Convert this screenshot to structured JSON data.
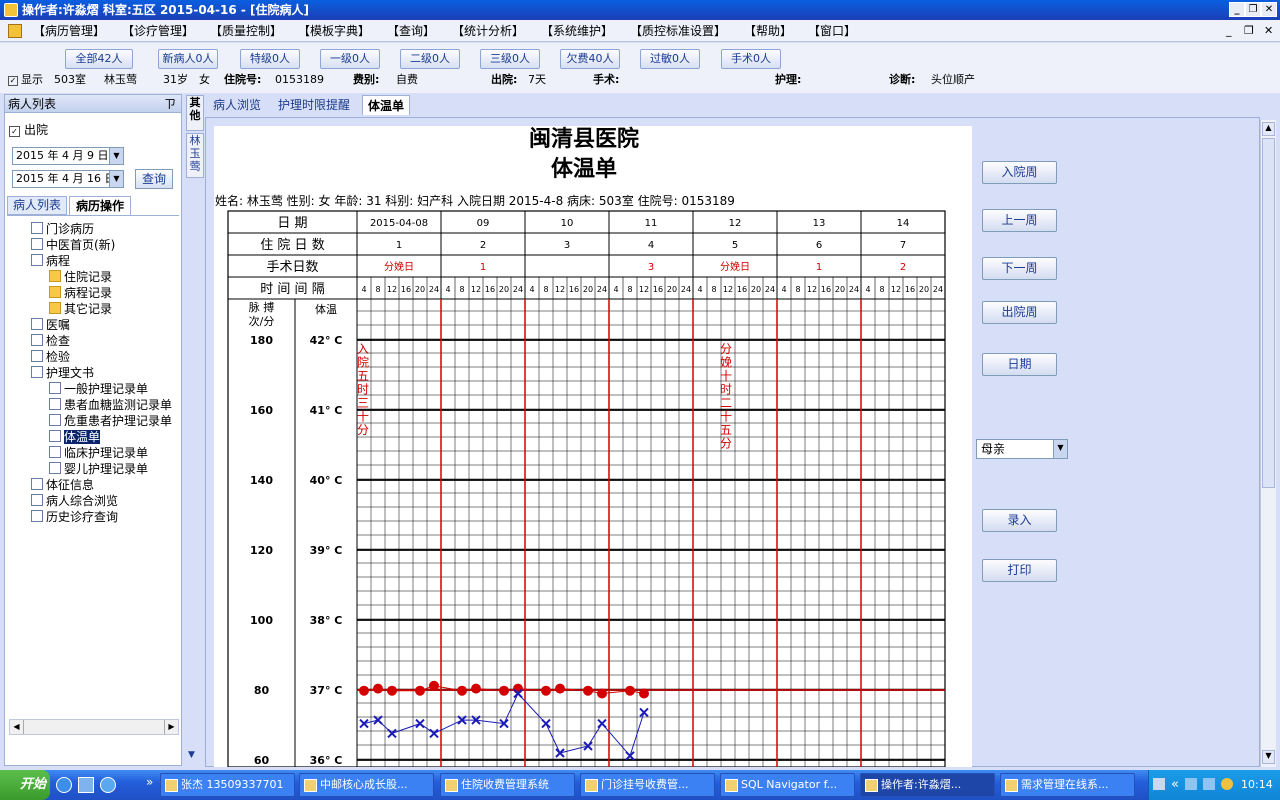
{
  "window": {
    "title": "操作者:许淼熠   科室:五区   2015-04-16 - [住院病人]"
  },
  "menu": [
    "【病历管理】",
    "【诊疗管理】",
    "【质量控制】",
    "【模板字典】",
    "【查询】",
    "【统计分析】",
    "【系统维护】",
    "【质控标准设置】",
    "【帮助】",
    "【窗口】"
  ],
  "filters": [
    "全部42人",
    "新病人0人",
    "特级0人",
    "一级0人",
    "二级0人",
    "三级0人",
    "欠费40人",
    "过敏0人",
    "手术0人"
  ],
  "patient_info": {
    "show": "显示",
    "room": "503室",
    "name": "林玉莺",
    "age": "31岁",
    "sex": "女",
    "inpatient_label": "住院号:",
    "inpatient_no": "0153189",
    "fee_label": "费别:",
    "fee": "自费",
    "discharge_label": "出院:",
    "discharge": "7天",
    "surgery_label": "手术:",
    "nursing_label": "护理:",
    "diagnosis_label": "诊断:",
    "diagnosis": "头位顺产"
  },
  "left_panel": {
    "title": "病人列表",
    "pin": "ㄗ",
    "discharge_check": "出院",
    "date_from": "2015 年 4 月 9 日",
    "date_to": "2015 年 4 月 16 日",
    "query": "查询",
    "tabs": [
      "病人列表",
      "病历操作"
    ],
    "tree": [
      "门诊病历",
      "中医首页(新)",
      "病程",
      "住院记录",
      "病程记录",
      "其它记录",
      "医嘱",
      "检查",
      "检验",
      "护理文书",
      "一般护理记录单",
      "患者血糖监测记录单",
      "危重患者护理记录单",
      "体温单",
      "临床护理记录单",
      "婴儿护理记录单",
      "体征信息",
      "病人综合浏览",
      "历史诊疗查询"
    ]
  },
  "side_tabs": {
    "other": "其他",
    "patient": "林玉莺"
  },
  "tabs": [
    "病人浏览",
    "护理时限提醒",
    "体温单"
  ],
  "sheet": {
    "hospital": "闽清县医院",
    "title": "体温单",
    "header_line": "姓名: 林玉莺   性别: 女  年龄: 31  科别: 妇产科     入院日期  2015-4-8    病床: 503室     住院号: 0153189",
    "row_date": "日    期",
    "row_day": "住 院 日 数",
    "row_op": "手术日数",
    "row_time": "时 间 间 隔",
    "dates": [
      "2015-04-08",
      "09",
      "10",
      "11",
      "12",
      "13",
      "14"
    ],
    "days": [
      "1",
      "2",
      "3",
      "4",
      "5",
      "6",
      "7"
    ],
    "op_days": [
      "分娩日",
      "1",
      "",
      "3",
      "分娩日",
      "1",
      "2"
    ],
    "hours": [
      "4",
      "8",
      "12",
      "16",
      "20",
      "24"
    ],
    "pulse_label": "脉 搏\n次/分",
    "temp_label": "体温",
    "pulse_ticks": [
      "180",
      "160",
      "140",
      "120",
      "100",
      "80",
      "60"
    ],
    "temp_ticks": [
      "42° C",
      "41° C",
      "40° C",
      "39° C",
      "38° C",
      "37° C",
      "36° C"
    ],
    "annot1": "入院五时三十分",
    "annot2": "分娩十时二十五分"
  },
  "chart_data": {
    "type": "line",
    "series": [
      {
        "values": [
          36.99,
          37.02,
          36.99,
          null,
          36.99,
          37.06,
          null,
          36.99,
          37.02,
          null,
          36.99,
          37.02,
          null,
          36.99,
          37.02,
          null,
          36.99,
          36.95,
          null,
          36.99,
          36.95
        ]
      },
      {
        "values": [
          36.52,
          36.57,
          36.38,
          null,
          36.52,
          36.38,
          null,
          36.57,
          36.57,
          null,
          36.52,
          36.95,
          null,
          36.52,
          36.1,
          null,
          36.2,
          36.52,
          null,
          36.06,
          36.68
        ]
      }
    ],
    "ylim": [
      36,
      42
    ]
  },
  "right_buttons": [
    "入院周",
    "上一周",
    "下一周",
    "出院周",
    "日期",
    "录入",
    "打印"
  ],
  "relation_select": "母亲",
  "taskbar": {
    "start": "开始",
    "tasks": [
      "张杰 13509337701",
      "中邮核心成长股...",
      "住院收费管理系统",
      "门诊挂号收费管...",
      "SQL Navigator f...",
      "操作者:许淼熠...",
      "需求管理在线系..."
    ],
    "clock": "10:14"
  },
  "colors": {
    "red": "#d40000",
    "blue": "#1a1ab8"
  }
}
